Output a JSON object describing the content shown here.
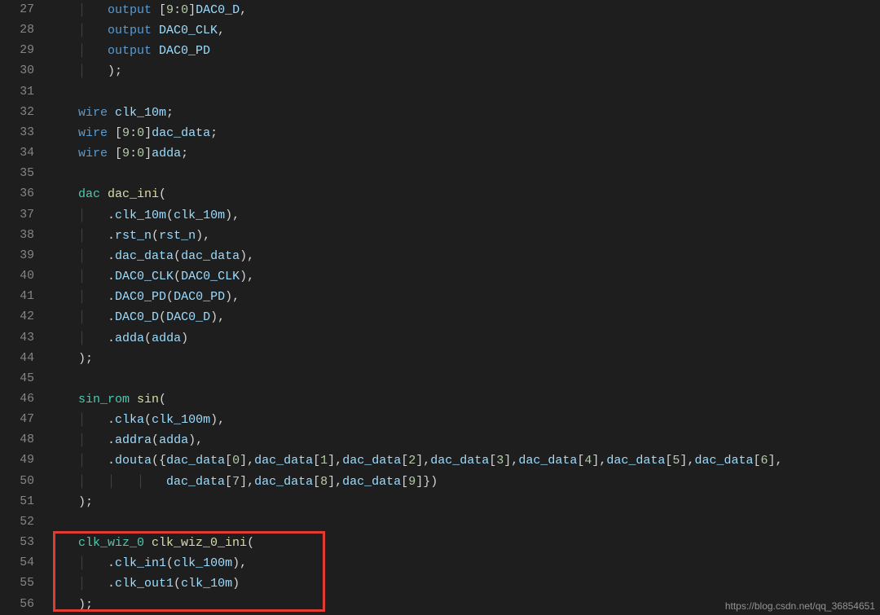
{
  "watermark": "https://blog.csdn.net/qq_36854651",
  "gutter": {
    "start": 27,
    "end": 56
  },
  "code": {
    "lines": [
      {
        "n": 27,
        "tokens": [
          {
            "c": "guide",
            "t": "    │   "
          },
          {
            "c": "kw",
            "t": "output "
          },
          {
            "c": "pun",
            "t": "["
          },
          {
            "c": "num",
            "t": "9"
          },
          {
            "c": "pun",
            "t": ":"
          },
          {
            "c": "num",
            "t": "0"
          },
          {
            "c": "pun",
            "t": "]"
          },
          {
            "c": "id",
            "t": "DAC0_D"
          },
          {
            "c": "pun",
            "t": ","
          }
        ]
      },
      {
        "n": 28,
        "tokens": [
          {
            "c": "guide",
            "t": "    │   "
          },
          {
            "c": "kw",
            "t": "output "
          },
          {
            "c": "id",
            "t": "DAC0_CLK"
          },
          {
            "c": "pun",
            "t": ","
          }
        ]
      },
      {
        "n": 29,
        "tokens": [
          {
            "c": "guide",
            "t": "    │   "
          },
          {
            "c": "kw",
            "t": "output "
          },
          {
            "c": "id",
            "t": "DAC0_PD"
          }
        ]
      },
      {
        "n": 30,
        "tokens": [
          {
            "c": "guide",
            "t": "    │   "
          },
          {
            "c": "pun",
            "t": ");"
          }
        ]
      },
      {
        "n": 31,
        "tokens": []
      },
      {
        "n": 32,
        "tokens": [
          {
            "c": "guide",
            "t": "    "
          },
          {
            "c": "kw",
            "t": "wire "
          },
          {
            "c": "id",
            "t": "clk_10m"
          },
          {
            "c": "pun",
            "t": ";"
          }
        ]
      },
      {
        "n": 33,
        "tokens": [
          {
            "c": "guide",
            "t": "    "
          },
          {
            "c": "kw",
            "t": "wire "
          },
          {
            "c": "pun",
            "t": "["
          },
          {
            "c": "num",
            "t": "9"
          },
          {
            "c": "pun",
            "t": ":"
          },
          {
            "c": "num",
            "t": "0"
          },
          {
            "c": "pun",
            "t": "]"
          },
          {
            "c": "id",
            "t": "dac_data"
          },
          {
            "c": "pun",
            "t": ";"
          }
        ]
      },
      {
        "n": 34,
        "tokens": [
          {
            "c": "guide",
            "t": "    "
          },
          {
            "c": "kw",
            "t": "wire "
          },
          {
            "c": "pun",
            "t": "["
          },
          {
            "c": "num",
            "t": "9"
          },
          {
            "c": "pun",
            "t": ":"
          },
          {
            "c": "num",
            "t": "0"
          },
          {
            "c": "pun",
            "t": "]"
          },
          {
            "c": "id",
            "t": "adda"
          },
          {
            "c": "pun",
            "t": ";"
          }
        ]
      },
      {
        "n": 35,
        "tokens": []
      },
      {
        "n": 36,
        "tokens": [
          {
            "c": "guide",
            "t": "    "
          },
          {
            "c": "typ",
            "t": "dac "
          },
          {
            "c": "fn",
            "t": "dac_ini"
          },
          {
            "c": "pun",
            "t": "("
          }
        ]
      },
      {
        "n": 37,
        "tokens": [
          {
            "c": "guide",
            "t": "    │   "
          },
          {
            "c": "pun",
            "t": "."
          },
          {
            "c": "id",
            "t": "clk_10m"
          },
          {
            "c": "pun",
            "t": "("
          },
          {
            "c": "id",
            "t": "clk_10m"
          },
          {
            "c": "pun",
            "t": "),"
          }
        ]
      },
      {
        "n": 38,
        "tokens": [
          {
            "c": "guide",
            "t": "    │   "
          },
          {
            "c": "pun",
            "t": "."
          },
          {
            "c": "id",
            "t": "rst_n"
          },
          {
            "c": "pun",
            "t": "("
          },
          {
            "c": "id",
            "t": "rst_n"
          },
          {
            "c": "pun",
            "t": "),"
          }
        ]
      },
      {
        "n": 39,
        "tokens": [
          {
            "c": "guide",
            "t": "    │   "
          },
          {
            "c": "pun",
            "t": "."
          },
          {
            "c": "id",
            "t": "dac_data"
          },
          {
            "c": "pun",
            "t": "("
          },
          {
            "c": "id",
            "t": "dac_data"
          },
          {
            "c": "pun",
            "t": "),"
          }
        ]
      },
      {
        "n": 40,
        "tokens": [
          {
            "c": "guide",
            "t": "    │   "
          },
          {
            "c": "pun",
            "t": "."
          },
          {
            "c": "id",
            "t": "DAC0_CLK"
          },
          {
            "c": "pun",
            "t": "("
          },
          {
            "c": "id",
            "t": "DAC0_CLK"
          },
          {
            "c": "pun",
            "t": "),"
          }
        ]
      },
      {
        "n": 41,
        "tokens": [
          {
            "c": "guide",
            "t": "    │   "
          },
          {
            "c": "pun",
            "t": "."
          },
          {
            "c": "id",
            "t": "DAC0_PD"
          },
          {
            "c": "pun",
            "t": "("
          },
          {
            "c": "id",
            "t": "DAC0_PD"
          },
          {
            "c": "pun",
            "t": "),"
          }
        ]
      },
      {
        "n": 42,
        "tokens": [
          {
            "c": "guide",
            "t": "    │   "
          },
          {
            "c": "pun",
            "t": "."
          },
          {
            "c": "id",
            "t": "DAC0_D"
          },
          {
            "c": "pun",
            "t": "("
          },
          {
            "c": "id",
            "t": "DAC0_D"
          },
          {
            "c": "pun",
            "t": "),"
          }
        ]
      },
      {
        "n": 43,
        "tokens": [
          {
            "c": "guide",
            "t": "    │   "
          },
          {
            "c": "pun",
            "t": "."
          },
          {
            "c": "id",
            "t": "adda"
          },
          {
            "c": "pun",
            "t": "("
          },
          {
            "c": "id",
            "t": "adda"
          },
          {
            "c": "pun",
            "t": ")"
          }
        ]
      },
      {
        "n": 44,
        "tokens": [
          {
            "c": "guide",
            "t": "    "
          },
          {
            "c": "pun",
            "t": ");"
          }
        ]
      },
      {
        "n": 45,
        "tokens": []
      },
      {
        "n": 46,
        "tokens": [
          {
            "c": "guide",
            "t": "    "
          },
          {
            "c": "typ",
            "t": "sin_rom "
          },
          {
            "c": "fn",
            "t": "sin"
          },
          {
            "c": "pun",
            "t": "("
          }
        ]
      },
      {
        "n": 47,
        "tokens": [
          {
            "c": "guide",
            "t": "    │   "
          },
          {
            "c": "pun",
            "t": "."
          },
          {
            "c": "id",
            "t": "clka"
          },
          {
            "c": "pun",
            "t": "("
          },
          {
            "c": "id",
            "t": "clk_100m"
          },
          {
            "c": "pun",
            "t": "),"
          }
        ]
      },
      {
        "n": 48,
        "tokens": [
          {
            "c": "guide",
            "t": "    │   "
          },
          {
            "c": "pun",
            "t": "."
          },
          {
            "c": "id",
            "t": "addra"
          },
          {
            "c": "pun",
            "t": "("
          },
          {
            "c": "id",
            "t": "adda"
          },
          {
            "c": "pun",
            "t": "),"
          }
        ]
      },
      {
        "n": 49,
        "tokens": [
          {
            "c": "guide",
            "t": "    │   "
          },
          {
            "c": "pun",
            "t": "."
          },
          {
            "c": "id",
            "t": "douta"
          },
          {
            "c": "pun",
            "t": "({"
          },
          {
            "c": "id",
            "t": "dac_data"
          },
          {
            "c": "pun",
            "t": "["
          },
          {
            "c": "num",
            "t": "0"
          },
          {
            "c": "pun",
            "t": "],"
          },
          {
            "c": "id",
            "t": "dac_data"
          },
          {
            "c": "pun",
            "t": "["
          },
          {
            "c": "num",
            "t": "1"
          },
          {
            "c": "pun",
            "t": "],"
          },
          {
            "c": "id",
            "t": "dac_data"
          },
          {
            "c": "pun",
            "t": "["
          },
          {
            "c": "num",
            "t": "2"
          },
          {
            "c": "pun",
            "t": "],"
          },
          {
            "c": "id",
            "t": "dac_data"
          },
          {
            "c": "pun",
            "t": "["
          },
          {
            "c": "num",
            "t": "3"
          },
          {
            "c": "pun",
            "t": "],"
          },
          {
            "c": "id",
            "t": "dac_data"
          },
          {
            "c": "pun",
            "t": "["
          },
          {
            "c": "num",
            "t": "4"
          },
          {
            "c": "pun",
            "t": "],"
          },
          {
            "c": "id",
            "t": "dac_data"
          },
          {
            "c": "pun",
            "t": "["
          },
          {
            "c": "num",
            "t": "5"
          },
          {
            "c": "pun",
            "t": "],"
          },
          {
            "c": "id",
            "t": "dac_data"
          },
          {
            "c": "pun",
            "t": "["
          },
          {
            "c": "num",
            "t": "6"
          },
          {
            "c": "pun",
            "t": "],"
          }
        ]
      },
      {
        "n": 50,
        "tokens": [
          {
            "c": "guide",
            "t": "    │   │   │   "
          },
          {
            "c": "id",
            "t": "dac_data"
          },
          {
            "c": "pun",
            "t": "["
          },
          {
            "c": "num",
            "t": "7"
          },
          {
            "c": "pun",
            "t": "],"
          },
          {
            "c": "id",
            "t": "dac_data"
          },
          {
            "c": "pun",
            "t": "["
          },
          {
            "c": "num",
            "t": "8"
          },
          {
            "c": "pun",
            "t": "],"
          },
          {
            "c": "id",
            "t": "dac_data"
          },
          {
            "c": "pun",
            "t": "["
          },
          {
            "c": "num",
            "t": "9"
          },
          {
            "c": "pun",
            "t": "]})"
          }
        ]
      },
      {
        "n": 51,
        "tokens": [
          {
            "c": "guide",
            "t": "    "
          },
          {
            "c": "pun",
            "t": ");"
          }
        ]
      },
      {
        "n": 52,
        "tokens": []
      },
      {
        "n": 53,
        "tokens": [
          {
            "c": "guide",
            "t": "    "
          },
          {
            "c": "typ",
            "t": "clk_wiz_0 "
          },
          {
            "c": "fn",
            "t": "clk_wiz_0_ini"
          },
          {
            "c": "pun",
            "t": "("
          }
        ]
      },
      {
        "n": 54,
        "tokens": [
          {
            "c": "guide",
            "t": "    │   "
          },
          {
            "c": "pun",
            "t": "."
          },
          {
            "c": "id",
            "t": "clk_in1"
          },
          {
            "c": "pun",
            "t": "("
          },
          {
            "c": "id",
            "t": "clk_100m"
          },
          {
            "c": "pun",
            "t": "),"
          }
        ]
      },
      {
        "n": 55,
        "tokens": [
          {
            "c": "guide",
            "t": "    │   "
          },
          {
            "c": "pun",
            "t": "."
          },
          {
            "c": "id",
            "t": "clk_out1"
          },
          {
            "c": "pun",
            "t": "("
          },
          {
            "c": "id",
            "t": "clk_10m"
          },
          {
            "c": "pun",
            "t": ")"
          }
        ]
      },
      {
        "n": 56,
        "tokens": [
          {
            "c": "guide",
            "t": "    "
          },
          {
            "c": "pun",
            "t": ");"
          }
        ]
      }
    ]
  }
}
